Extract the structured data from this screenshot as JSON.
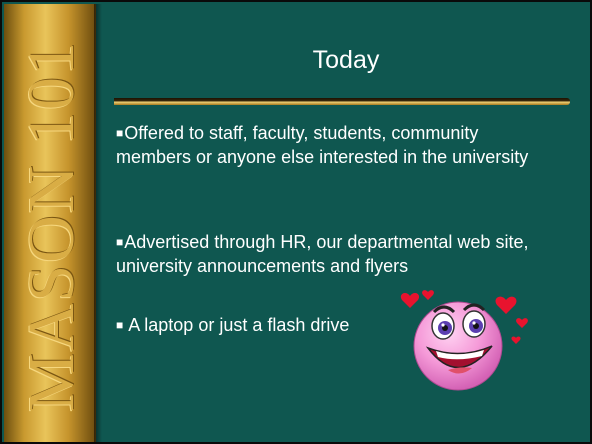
{
  "sidebar": {
    "text": "MASON 101"
  },
  "slide": {
    "title": "Today",
    "bullets": [
      "Offered to staff, faculty, students, community members or anyone else interested in the university",
      "Advertised through HR, our departmental web site, university announcements and flyers",
      " A laptop or just a  flash drive"
    ]
  },
  "colors": {
    "background": "#0f5750",
    "gold": "#d9ad45",
    "text": "#ffffff"
  },
  "icons": {
    "emoji": "heart-eyes-smiley-icon"
  }
}
